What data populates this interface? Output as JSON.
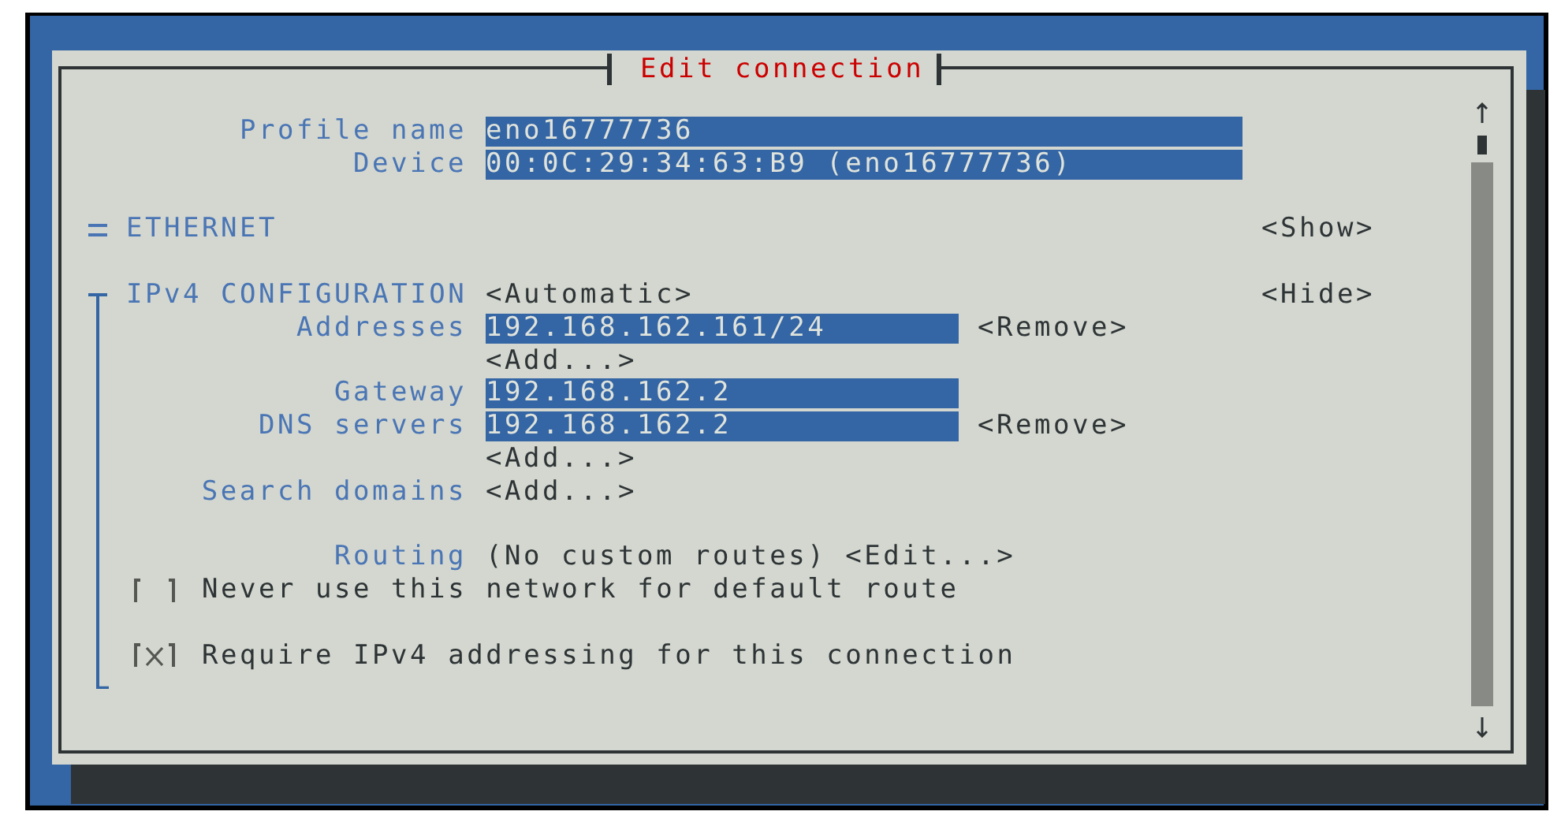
{
  "dialog": {
    "title": "Edit connection"
  },
  "profile_name": {
    "label": "Profile name",
    "value": "eno16777736"
  },
  "device": {
    "label": "Device",
    "value": "00:0C:29:34:63:B9 (eno16777736)"
  },
  "sections": [
    {
      "title": "ETHERNET",
      "expanded": false,
      "toggle": "<Show>"
    },
    {
      "title": "IPv4 CONFIGURATION",
      "expanded": true,
      "mode": "<Automatic>",
      "toggle": "<Hide>"
    }
  ],
  "ipv4": {
    "addresses": {
      "label": "Addresses",
      "items": [
        {
          "value": "192.168.162.161/24",
          "remove": "<Remove>"
        }
      ],
      "add": "<Add...>"
    },
    "gateway": {
      "label": "Gateway",
      "value": "192.168.162.2"
    },
    "dns_servers": {
      "label": "DNS servers",
      "items": [
        {
          "value": "192.168.162.2",
          "remove": "<Remove>"
        }
      ],
      "add": "<Add...>"
    },
    "search_domains": {
      "label": "Search domains",
      "add": "<Add...>"
    },
    "routing": {
      "label": "Routing",
      "value": "(No custom routes)",
      "edit": "<Edit...>"
    },
    "checkboxes": [
      {
        "label": "Never use this network for default route",
        "checked": false
      },
      {
        "label": "Require IPv4 addressing for this connection",
        "checked": true
      }
    ]
  }
}
